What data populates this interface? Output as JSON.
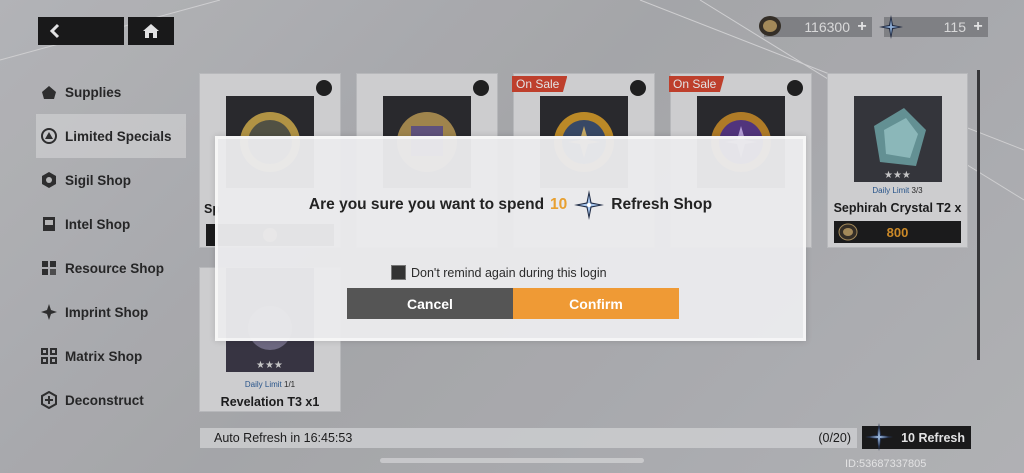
{
  "topbar": {
    "currency_coins": "116300",
    "currency_stars": "115"
  },
  "sidebar": {
    "items": [
      {
        "label": "Supplies"
      },
      {
        "label": "Limited Specials"
      },
      {
        "label": "Sigil Shop"
      },
      {
        "label": "Intel Shop"
      },
      {
        "label": "Resource Shop"
      },
      {
        "label": "Imprint Shop"
      },
      {
        "label": "Matrix Shop"
      },
      {
        "label": "Deconstruct"
      }
    ]
  },
  "cards": {
    "sale_label": "On Sale",
    "card1_partial": "Sp",
    "card5": {
      "limit_label": "Daily Limit ",
      "limit_value": "3/3",
      "name": "Sephirah Crystal T2 x",
      "price": "800"
    },
    "card6": {
      "limit_label": "Daily Limit ",
      "limit_value": "1/1",
      "name": "Revelation T3 x1"
    }
  },
  "bottom": {
    "auto_refresh": "Auto Refresh in 16:45:53",
    "refresh_count": "(0/20)",
    "refresh_button": "10 Refresh",
    "id_text": "ID:53687337805"
  },
  "dialog": {
    "msg_prefix": "Are you sure you want to spend",
    "amount": "10",
    "msg_suffix": "Refresh Shop",
    "remind_label": "Don't remind again during this login",
    "cancel": "Cancel",
    "confirm": "Confirm"
  },
  "colors": {
    "accent": "#ef9a35",
    "sale": "#d6462f",
    "limit_blue": "#2d5f9b"
  }
}
